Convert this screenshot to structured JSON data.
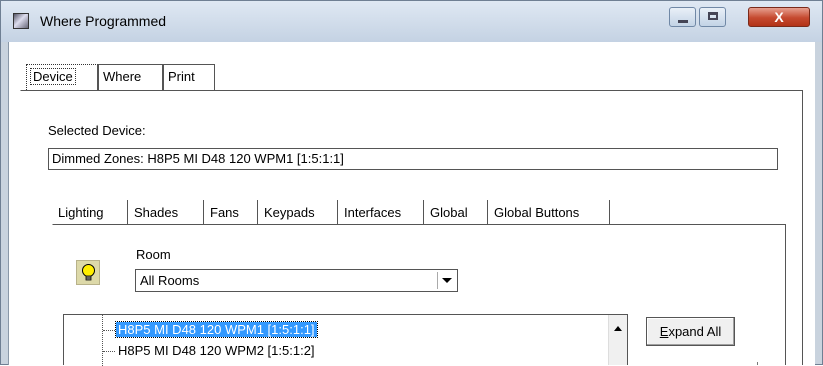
{
  "window": {
    "title": "Where Programmed",
    "close_glyph": "X"
  },
  "outer_tabs": [
    {
      "label": "Device",
      "active": true
    },
    {
      "label": "Where",
      "active": false
    },
    {
      "label": "Print",
      "active": false
    }
  ],
  "device": {
    "selected_label": "Selected Device:",
    "selected_value": "Dimmed Zones: H8P5 MI D48 120 WPM1 [1:5:1:1]"
  },
  "inner_tabs": [
    {
      "label": "Lighting",
      "active": true
    },
    {
      "label": "Shades",
      "active": false
    },
    {
      "label": "Fans",
      "active": false
    },
    {
      "label": "Keypads",
      "active": false
    },
    {
      "label": "Interfaces",
      "active": false
    },
    {
      "label": "Global",
      "active": false
    },
    {
      "label": "Global Buttons",
      "active": false
    }
  ],
  "lighting": {
    "icon": "lightbulb-icon",
    "room_label": "Room",
    "room_value": "All Rooms",
    "tree_items": [
      {
        "label": "H8P5 MI D48 120 WPM1 [1:5:1:1]",
        "selected": true
      },
      {
        "label": "H8P5 MI D48 120 WPM2 [1:5:1:2]",
        "selected": false
      }
    ],
    "expand_all_label": "xpand All",
    "expand_all_accel": "E"
  },
  "colors": {
    "selection": "#3399ff",
    "close_button": "#c5492f",
    "titlebar": "#c4d2e3"
  }
}
